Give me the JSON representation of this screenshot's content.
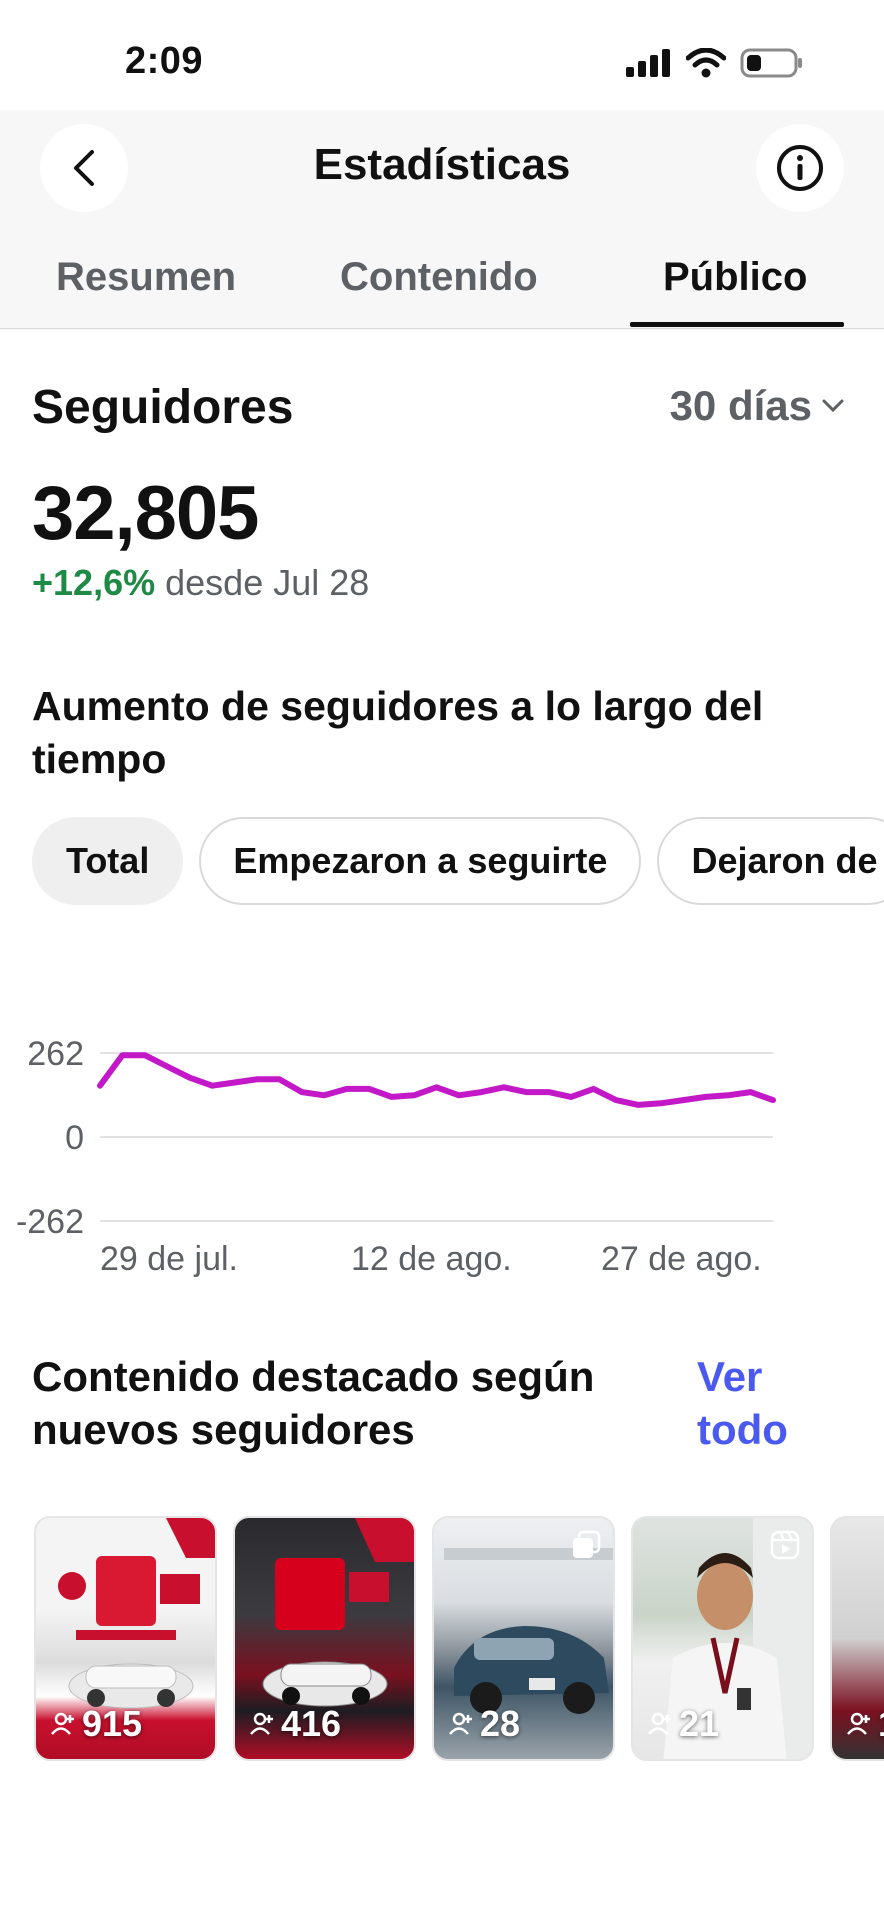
{
  "status_bar": {
    "time": "2:09"
  },
  "header": {
    "title": "Estadísticas"
  },
  "tabs": [
    {
      "label": "Resumen",
      "active": false
    },
    {
      "label": "Contenido",
      "active": false
    },
    {
      "label": "Público",
      "active": true
    }
  ],
  "followers": {
    "heading": "Seguidores",
    "period": "30 días",
    "count": "32,805",
    "delta": "+12,6%",
    "since": "desde Jul 28"
  },
  "growth": {
    "title": "Aumento de seguidores a lo largo del tiempo",
    "filters": [
      {
        "label": "Total",
        "active": true
      },
      {
        "label": "Empezaron a seguirte",
        "active": false
      },
      {
        "label": "Dejaron de",
        "active": false
      }
    ]
  },
  "chart_data": {
    "type": "line",
    "title": "",
    "xlabel": "",
    "ylabel": "",
    "ylim": [
      -262,
      262
    ],
    "y_ticks": [
      "262",
      "0",
      "-262"
    ],
    "x_tick_labels": [
      "29 de jul.",
      "12 de ago.",
      "27 de ago."
    ],
    "color": "#c218c8",
    "grid": true,
    "series": [
      {
        "values": [
          160,
          255,
          255,
          220,
          185,
          160,
          170,
          180,
          180,
          140,
          130,
          150,
          150,
          125,
          130,
          155,
          130,
          140,
          155,
          140,
          140,
          125,
          150,
          115,
          100,
          105,
          115,
          125,
          130,
          140,
          115
        ]
      }
    ]
  },
  "featured": {
    "title": "Contenido destacado según nuevos seguidores",
    "see_all": "Ver todo",
    "items": [
      {
        "count": "915",
        "kind": "promo-red"
      },
      {
        "count": "416",
        "kind": "promo-dark"
      },
      {
        "count": "28",
        "kind": "showroom"
      },
      {
        "count": "21",
        "kind": "reel"
      },
      {
        "count": "1",
        "kind": "partial"
      }
    ]
  },
  "colors": {
    "accent_link": "#4a5af0",
    "positive": "#1f8a45",
    "line": "#c218c8"
  }
}
